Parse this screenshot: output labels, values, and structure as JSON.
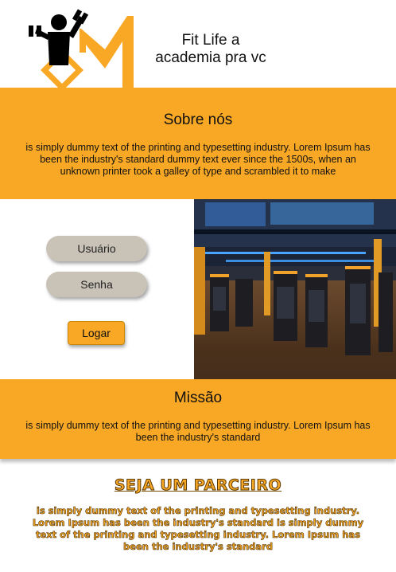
{
  "header": {
    "brand_line1": "Fit Life a",
    "brand_line2": "academia pra vc",
    "logo_icon": "weightlifter-m-logo"
  },
  "sobre": {
    "title": "Sobre nós",
    "text": "is simply dummy text of the printing and typesetting industry. Lorem Ipsum has been the industry's standard dummy text ever since the 1500s, when an unknown printer took a galley of type and scrambled it to make"
  },
  "login": {
    "user_label": "Usuário",
    "pass_label": "Senha",
    "submit_label": "Logar"
  },
  "missao": {
    "title": "Missão",
    "text": "is simply dummy text of the printing and typesetting industry. Lorem Ipsum has been the industry's standard"
  },
  "parceiro": {
    "title": "SEJA UM PARCEIRO",
    "text": "is simply dummy text of the printing and typesetting industry. Lorem Ipsum has been the industry's standard is simply dummy text of the printing and typesetting industry. Lorem Ipsum has been the industry's standard"
  },
  "colors": {
    "accent": "#f9a825",
    "pill": "#c9c3b7"
  }
}
